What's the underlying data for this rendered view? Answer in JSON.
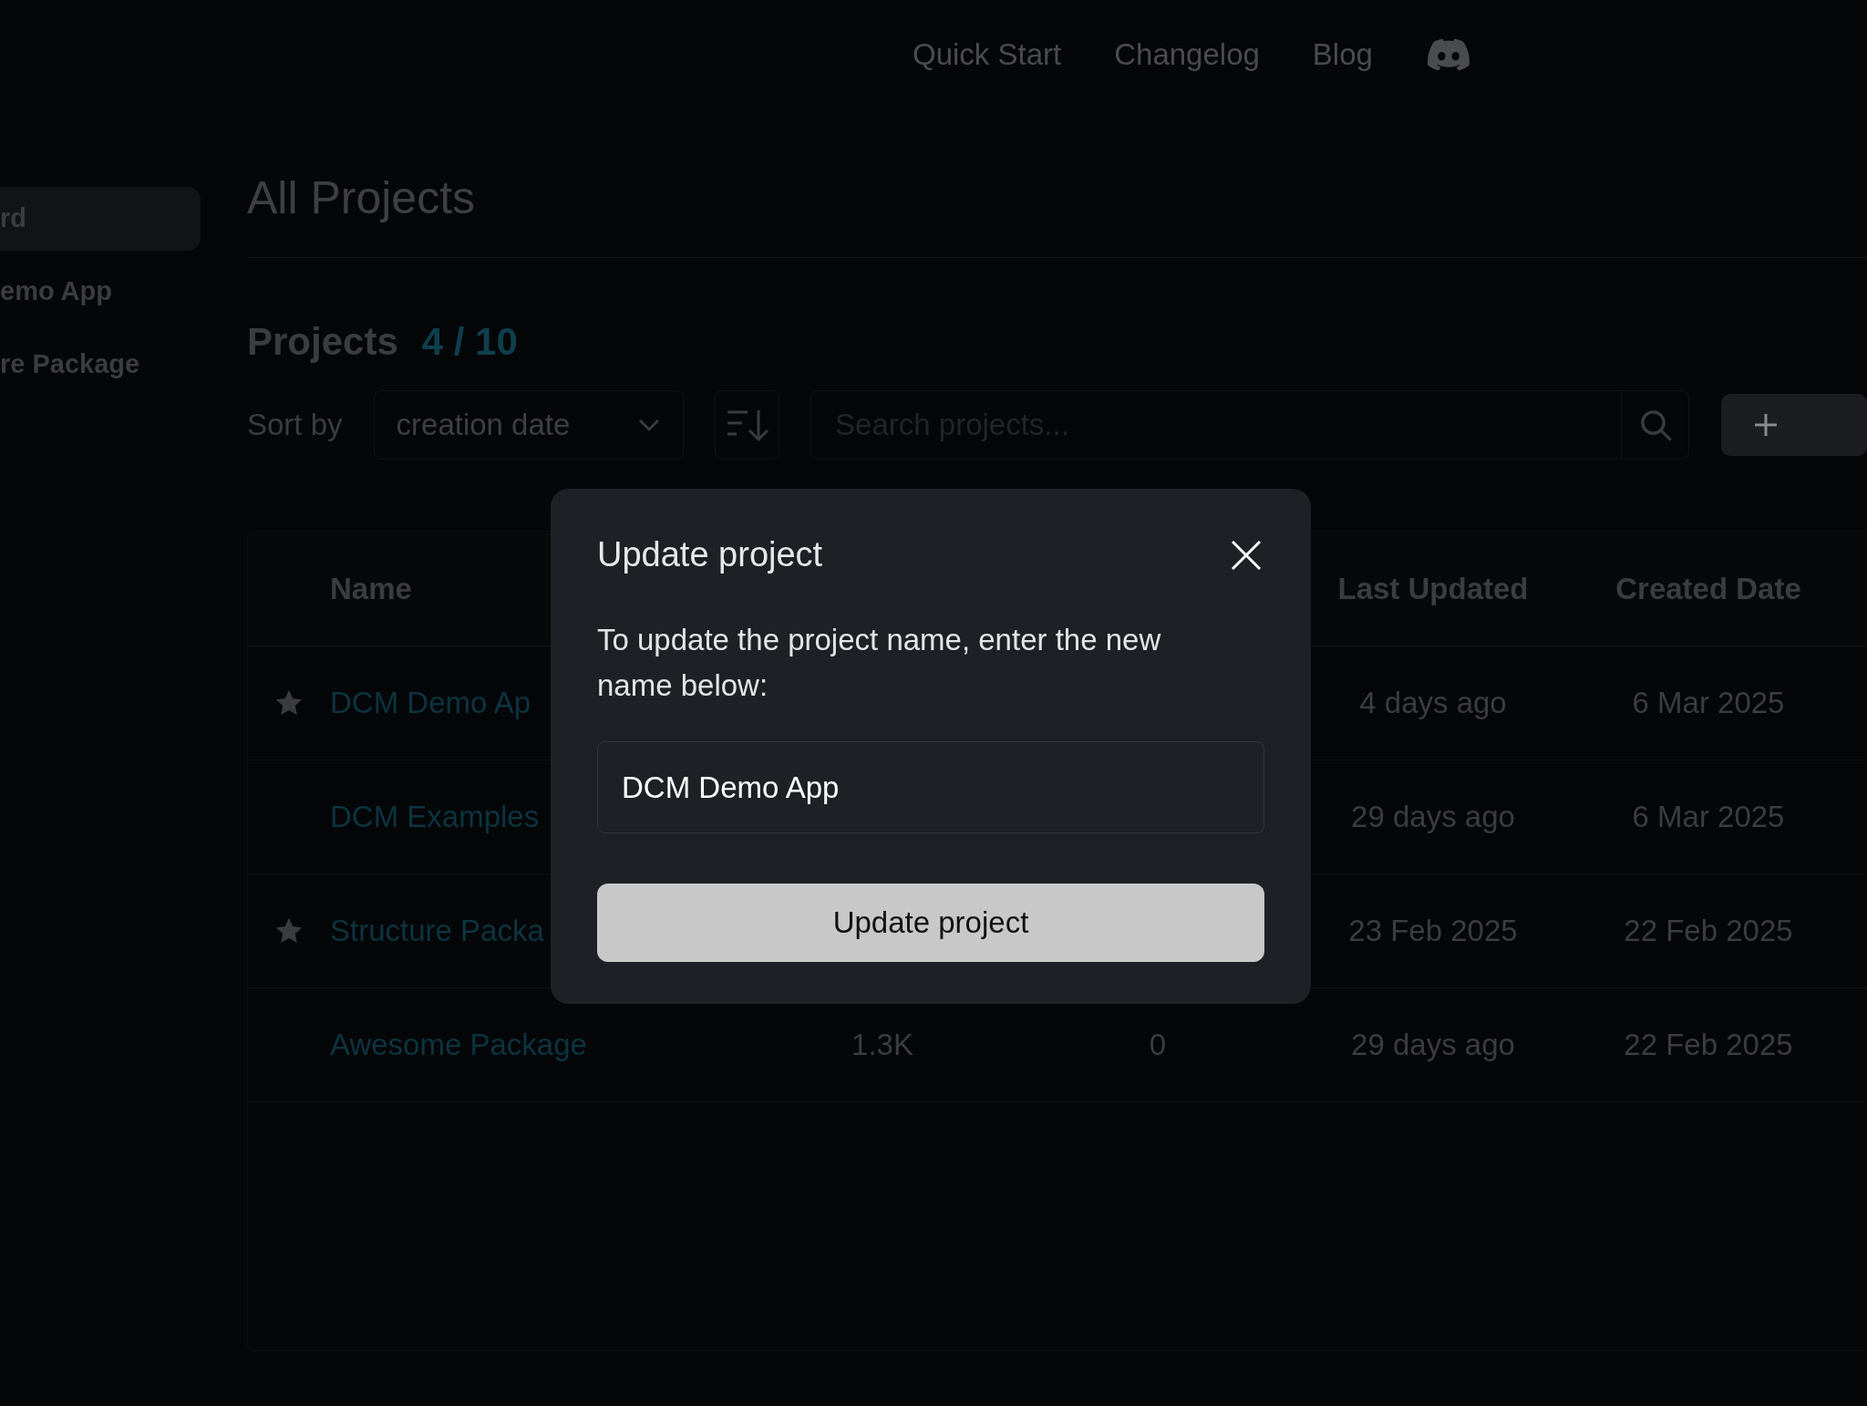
{
  "top_nav": {
    "links": [
      "Quick Start",
      "Changelog",
      "Blog"
    ]
  },
  "sidebar": {
    "items": [
      {
        "label": "rd",
        "selected": true
      },
      {
        "label": "emo App",
        "selected": false
      },
      {
        "label": "re Package",
        "selected": false
      }
    ]
  },
  "page_title": "All Projects",
  "projects_heading": {
    "label": "Projects",
    "count": "4 / 10"
  },
  "toolbar": {
    "sort_label": "Sort by",
    "sort_value": "creation date",
    "search_placeholder": "Search projects..."
  },
  "table": {
    "columns": [
      "Name",
      "Last Updated",
      "Created Date"
    ],
    "rows": [
      {
        "starred": true,
        "name": "DCM Demo Ap",
        "last_updated": "4 days ago",
        "created": "6 Mar 2025"
      },
      {
        "starred": false,
        "name": "DCM Examples",
        "last_updated": "29 days ago",
        "created": "6 Mar 2025"
      },
      {
        "starred": true,
        "name": "Structure Packa",
        "last_updated": "23 Feb 2025",
        "created": "22 Feb 2025"
      },
      {
        "starred": false,
        "name": "Awesome Package",
        "column_2": "1.3K",
        "column_3": "0",
        "last_updated": "29 days ago",
        "created": "22 Feb 2025"
      }
    ]
  },
  "dialog": {
    "title": "Update project",
    "description": "To update the project name, enter the new name below:",
    "value": "DCM Demo App",
    "button": "Update project"
  }
}
